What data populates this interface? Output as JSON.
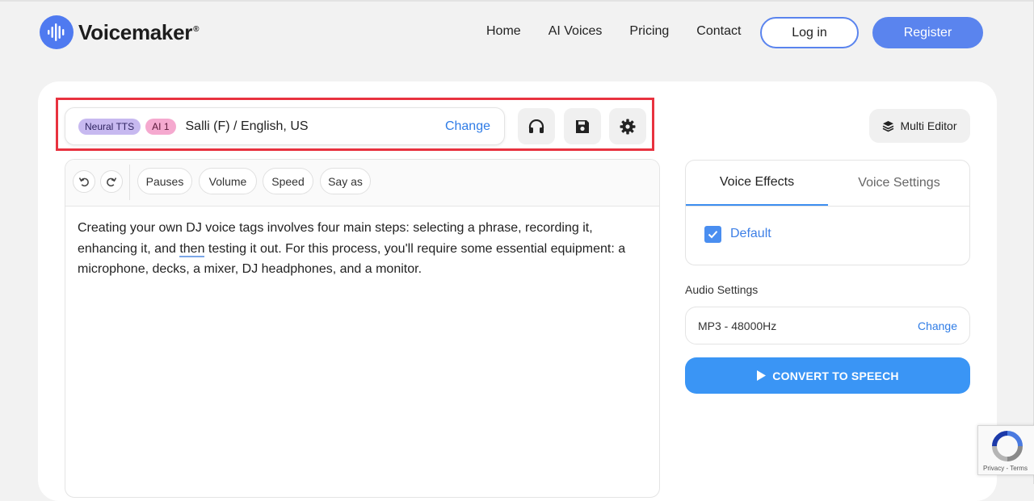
{
  "brand": {
    "name": "Voicemaker",
    "registered_mark": "®",
    "logo_icon": "soundwave-icon",
    "color": "#4f7af0"
  },
  "nav": {
    "items": [
      {
        "label": "Home"
      },
      {
        "label": "AI Voices"
      },
      {
        "label": "Pricing"
      },
      {
        "label": "Contact"
      }
    ],
    "login_label": "Log in",
    "register_label": "Register"
  },
  "voice_bar": {
    "badge_neural": "Neural TTS",
    "badge_ai": "AI 1",
    "voice": "Salli (F) / English, US",
    "change_label": "Change"
  },
  "toolbar_icons": [
    "headphones-icon",
    "save-icon",
    "settings-gear-icon"
  ],
  "multi_editor": {
    "label": "Multi Editor",
    "icon": "layers-icon"
  },
  "editor": {
    "toolbar": {
      "undo_icon": "undo-icon",
      "redo_icon": "redo-icon",
      "pauses": "Pauses",
      "volume": "Volume",
      "speed": "Speed",
      "say_as": "Say as"
    },
    "text_before": "Creating your own DJ voice tags involves four main steps: selecting a phrase, recording it, enhancing it, and ",
    "text_underlined": "then",
    "text_after": " testing it out. For this process, you'll require some essential equipment: a microphone, decks, a mixer, DJ headphones, and a monitor."
  },
  "effects": {
    "tab_effects": "Voice Effects",
    "tab_settings": "Voice Settings",
    "default_label": "Default",
    "default_checked": true
  },
  "audio": {
    "title": "Audio Settings",
    "format": "MP3 - 48000Hz",
    "change_label": "Change"
  },
  "convert": {
    "label": "CONVERT TO SPEECH",
    "icon": "play-icon",
    "color": "#3a95f5"
  },
  "recaptcha": {
    "terms": "Privacy - Terms"
  },
  "colors": {
    "highlight": "#e8323f",
    "link": "#2f7ce6"
  }
}
